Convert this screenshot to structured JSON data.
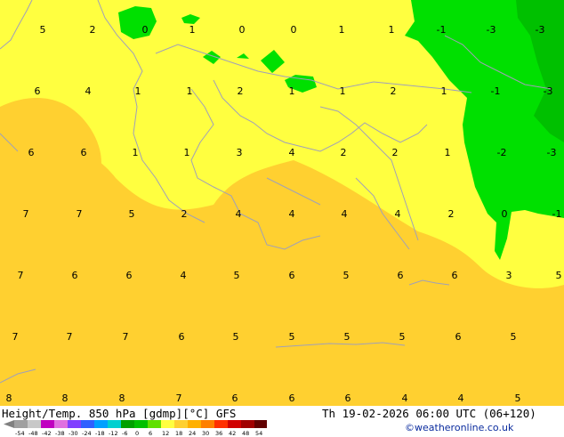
{
  "footer": {
    "product": "Height/Temp. 850 hPa [gdmp][°C] GFS",
    "valid_time": "Th 19-02-2026 06:00 UTC (06+120)",
    "credit": "©weatheronline.co.uk"
  },
  "legend": {
    "ticks": [
      "-54",
      "-48",
      "-42",
      "-38",
      "-30",
      "-24",
      "-18",
      "-12",
      "-6",
      "0",
      "6",
      "12",
      "18",
      "24",
      "30",
      "36",
      "42",
      "48",
      "54"
    ],
    "colors": [
      "#a0a0a0",
      "#c8c8c8",
      "#c000c0",
      "#e070e0",
      "#8040ff",
      "#3060ff",
      "#00a0ff",
      "#00d0d0",
      "#00a000",
      "#00c000",
      "#60e000",
      "#ffff40",
      "#ffd030",
      "#ffb000",
      "#ff8000",
      "#ff3000",
      "#d00000",
      "#a00000",
      "#600000"
    ]
  },
  "map_colors": {
    "band_0_6": "#ffff40",
    "band_6_12": "#ffd030",
    "band_minus6_0": "#00e000",
    "band_minus12_minus6": "#00c000",
    "border_lines": "#a0a0b8"
  },
  "temperature_labels": [
    {
      "t": "5"
    },
    {
      "t": "2"
    },
    {
      "t": "0"
    },
    {
      "t": "1"
    },
    {
      "t": "0"
    },
    {
      "t": "0"
    },
    {
      "t": "1"
    },
    {
      "t": "1"
    },
    {
      "t": "-1"
    },
    {
      "t": "-3"
    },
    {
      "t": "-3"
    },
    {
      "t": "6"
    },
    {
      "t": "4"
    },
    {
      "t": "1"
    },
    {
      "t": "1"
    },
    {
      "t": "2"
    },
    {
      "t": "1"
    },
    {
      "t": "1"
    },
    {
      "t": "2"
    },
    {
      "t": "1"
    },
    {
      "t": "-1"
    },
    {
      "t": "-3"
    },
    {
      "t": "6"
    },
    {
      "t": "6"
    },
    {
      "t": "1"
    },
    {
      "t": "1"
    },
    {
      "t": "3"
    },
    {
      "t": "4"
    },
    {
      "t": "2"
    },
    {
      "t": "2"
    },
    {
      "t": "1"
    },
    {
      "t": "-2"
    },
    {
      "t": "-3"
    },
    {
      "t": "7"
    },
    {
      "t": "7"
    },
    {
      "t": "5"
    },
    {
      "t": "2"
    },
    {
      "t": "4"
    },
    {
      "t": "4"
    },
    {
      "t": "4"
    },
    {
      "t": "4"
    },
    {
      "t": "2"
    },
    {
      "t": "0"
    },
    {
      "t": "-1"
    },
    {
      "t": "7"
    },
    {
      "t": "6"
    },
    {
      "t": "6"
    },
    {
      "t": "4"
    },
    {
      "t": "5"
    },
    {
      "t": "6"
    },
    {
      "t": "5"
    },
    {
      "t": "6"
    },
    {
      "t": "6"
    },
    {
      "t": "3"
    },
    {
      "t": "5"
    },
    {
      "t": "7"
    },
    {
      "t": "7"
    },
    {
      "t": "7"
    },
    {
      "t": "6"
    },
    {
      "t": "5"
    },
    {
      "t": "5"
    },
    {
      "t": "5"
    },
    {
      "t": "5"
    },
    {
      "t": "6"
    },
    {
      "t": "5"
    },
    {
      "t": "8"
    },
    {
      "t": "8"
    },
    {
      "t": "8"
    },
    {
      "t": "7"
    },
    {
      "t": "6"
    },
    {
      "t": "6"
    },
    {
      "t": "6"
    },
    {
      "t": "4"
    },
    {
      "t": "4"
    },
    {
      "t": "5"
    }
  ]
}
